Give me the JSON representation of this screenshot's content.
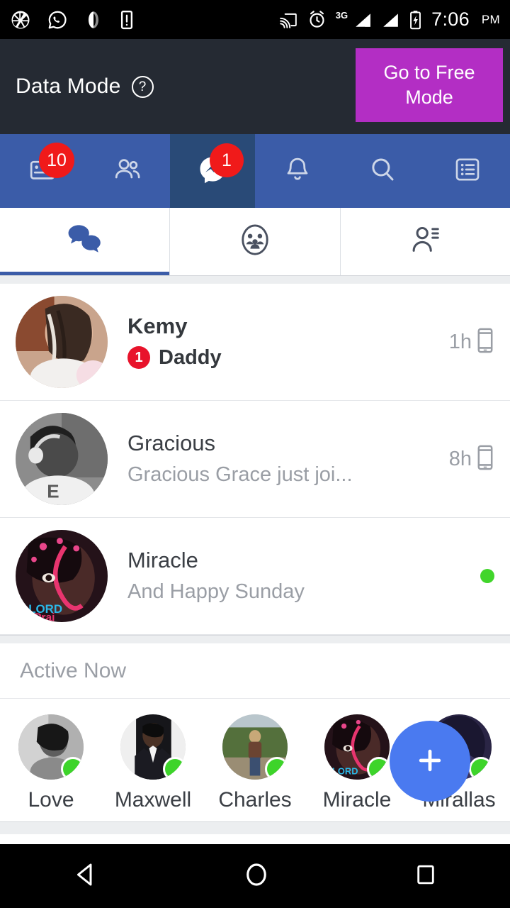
{
  "statusbar": {
    "left_icons": [
      "camera-aperture-icon",
      "whatsapp-icon",
      "opera-icon",
      "warning-icon"
    ],
    "right_icons": [
      "cast-icon",
      "alarm-icon",
      "signal-3g-icon",
      "signal-icon",
      "battery-charging-icon"
    ],
    "network": "3G",
    "time": "7:06",
    "ampm": "PM"
  },
  "header": {
    "title": "Data Mode",
    "help_icon": "question-mark-icon",
    "button_label": "Go to Free Mode",
    "button_color": "#b32ec4",
    "background": "#252a33"
  },
  "navbar": {
    "background": "#3b5ca8",
    "active_background": "#294a77",
    "badge_color": "#f01a1a",
    "items": [
      {
        "name": "newsfeed",
        "icon": "newsfeed-icon",
        "badge": "10",
        "active": false
      },
      {
        "name": "friends",
        "icon": "friends-icon",
        "badge": "",
        "active": false
      },
      {
        "name": "messenger",
        "icon": "messenger-icon",
        "badge": "1",
        "active": true
      },
      {
        "name": "notifications",
        "icon": "bell-icon",
        "badge": "",
        "active": false
      },
      {
        "name": "search",
        "icon": "search-icon",
        "badge": "",
        "active": false
      },
      {
        "name": "menu",
        "icon": "list-menu-icon",
        "badge": "",
        "active": false
      }
    ]
  },
  "subtabs": {
    "accent": "#3b5ca8",
    "items": [
      {
        "name": "chats",
        "icon": "chat-bubbles-icon",
        "active": true
      },
      {
        "name": "groups",
        "icon": "group-circle-icon",
        "active": false
      },
      {
        "name": "contacts",
        "icon": "person-list-icon",
        "active": false
      }
    ]
  },
  "conversations": [
    {
      "name": "Kemy",
      "snippet": "Daddy",
      "unread": true,
      "unread_count": "1",
      "time": "1h",
      "device_icon": "mobile-phone-icon",
      "online": false,
      "avatar_colors": [
        "#b06a4e",
        "#e8d5c8",
        "#8a4a30"
      ]
    },
    {
      "name": "Gracious",
      "snippet": "Gracious Grace just joi...",
      "unread": false,
      "unread_count": "",
      "time": "8h",
      "device_icon": "mobile-phone-icon",
      "online": false,
      "avatar_colors": [
        "#4a4a4a",
        "#9b9b9b",
        "#2c2c2c"
      ]
    },
    {
      "name": "Miracle",
      "snippet": "And Happy Sunday",
      "unread": false,
      "unread_count": "",
      "time": "",
      "device_icon": "",
      "online": true,
      "avatar_colors": [
        "#3a2028",
        "#d6356f",
        "#1d1016"
      ]
    }
  ],
  "active_now": {
    "title": "Active Now",
    "online_dot_color": "#3dd42a",
    "contacts": [
      {
        "name": "Love",
        "avatar_colors": [
          "#8c8c8c",
          "#cfcfcf",
          "#5a5a5a"
        ]
      },
      {
        "name": "Maxwell",
        "avatar_colors": [
          "#1b1b1b",
          "#e8e8e8",
          "#3a3a3a"
        ]
      },
      {
        "name": "Charles",
        "avatar_colors": [
          "#6f8a56",
          "#c9c2a6",
          "#4a5a3a"
        ]
      },
      {
        "name": "Miracle",
        "avatar_colors": [
          "#3a2028",
          "#d6356f",
          "#1d1016"
        ]
      },
      {
        "name": "Mirallas",
        "avatar_colors": [
          "#2a2545",
          "#151329",
          "#3a3460"
        ]
      }
    ],
    "fab": {
      "icon": "plus-icon",
      "label": "+",
      "color": "#4a7af0"
    }
  },
  "android_nav": {
    "back": "back-triangle-icon",
    "home": "home-circle-icon",
    "recents": "recents-square-icon"
  }
}
